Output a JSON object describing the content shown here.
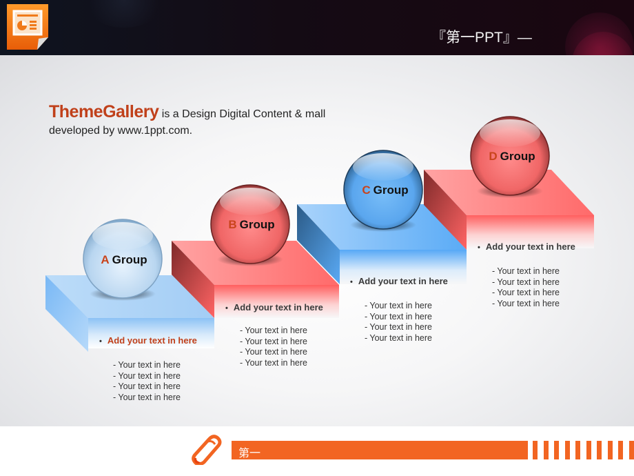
{
  "header": {
    "title": "『第一PPT』—",
    "logo_icon": "powerpoint-icon",
    "accent_color": "#f7931e"
  },
  "intro": {
    "brand": "ThemeGallery",
    "line1_rest": " is a Design Digital Content &  mall",
    "line2": "developed by www.1ppt.com."
  },
  "steps": [
    {
      "letter": "A",
      "label": "Group",
      "color": "blue-light",
      "heading": "Add your text in here",
      "items": [
        "- Your text in here",
        "- Your text in here",
        "- Your text in here",
        "- Your text in here"
      ]
    },
    {
      "letter": "B",
      "label": "Group",
      "color": "red",
      "heading": "Add your text in here",
      "items": [
        "- Your text in here",
        "- Your text in here",
        "- Your text in here",
        "- Your text in here"
      ]
    },
    {
      "letter": "C",
      "label": "Group",
      "color": "blue",
      "heading": "Add your text in here",
      "items": [
        "- Your text in here",
        "- Your text in here",
        "- Your text in here",
        "- Your text in here"
      ]
    },
    {
      "letter": "D",
      "label": "Group",
      "color": "red",
      "heading": "Add your text in here",
      "items": [
        "- Your text in here",
        "- Your text in here",
        "- Your text in here",
        "- Your text in here"
      ]
    }
  ],
  "colors": {
    "brand_text": "#c0401a",
    "footer_orange": "#f26522",
    "red_step": "#ff6b6b",
    "blue_step": "#5aaaf5",
    "light_blue_step": "#a9d3f7"
  },
  "footer": {
    "label": "第一",
    "icon": "pencil-icon"
  }
}
